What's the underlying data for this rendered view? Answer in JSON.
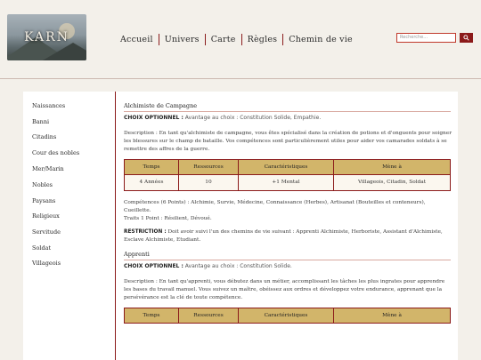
{
  "header": {
    "logo_text": "KARN",
    "nav": [
      "Accueil",
      "Univers",
      "Carte",
      "Règles",
      "Chemin de vie"
    ],
    "search_placeholder": "Recherche..."
  },
  "sidebar": {
    "items": [
      "Naissances",
      "Banni",
      "Citadins",
      "Cour des nobles",
      "Mer/Marin",
      "Nobles",
      "Paysans",
      "Religieux",
      "Servitude",
      "Soldat",
      "Villageois"
    ]
  },
  "sections": [
    {
      "title": "Alchimiste de Campagne",
      "choix_label": "CHOIX OPTIONNEL :",
      "choix_text": "Avantage au choix : Constitution Solide, Empathie.",
      "description": "Description : En tant qu'alchimiste de campagne, vous êtes spécialisé dans la création de potions et d'onguents pour soigner les blessures sur le champ de bataille. Vos compétences sont particulièrement utiles pour aider vos camarades soldats à se remettre des affres de la guerre.",
      "table_headers": [
        "Temps",
        "Ressources",
        "Caractéristiques",
        "Mène à"
      ],
      "table_row": [
        "4 Années",
        "10",
        "+1 Mental",
        "Villageois, Citadin, Soldat"
      ],
      "competences": "Compétences (6 Points) : Alchimie, Survie, Médecine, Connaissance (Herbes), Artisanat (Bouteilles et conteneurs), Cueillette.",
      "traits": "Traits 1 Point : Résilient, Dévoué.",
      "restriction_label": "RESTRICTION :",
      "restriction_text": "Doit avoir suivi l'un des chemins de vie suivant : Apprenti Alchimiste, Herboriste, Assistant d'Alchimiste, Esclave Alchimiste, Etudiant."
    },
    {
      "title": "Apprenti",
      "choix_label": "CHOIX OPTIONNEL :",
      "choix_text": "Avantage au choix : Constitution Solide.",
      "description": "Description : En tant qu'apprenti, vous débutez dans un métier, accomplissant les tâches les plus ingrates pour apprendre les bases du travail manuel. Vous suivez un maître, obéissez aux ordres et développez votre endurance, apprenant que la persévérance est la clé de toute compétence.",
      "table_headers": [
        "Temps",
        "Ressources",
        "Caractéristiques",
        "Mène à"
      ]
    }
  ]
}
